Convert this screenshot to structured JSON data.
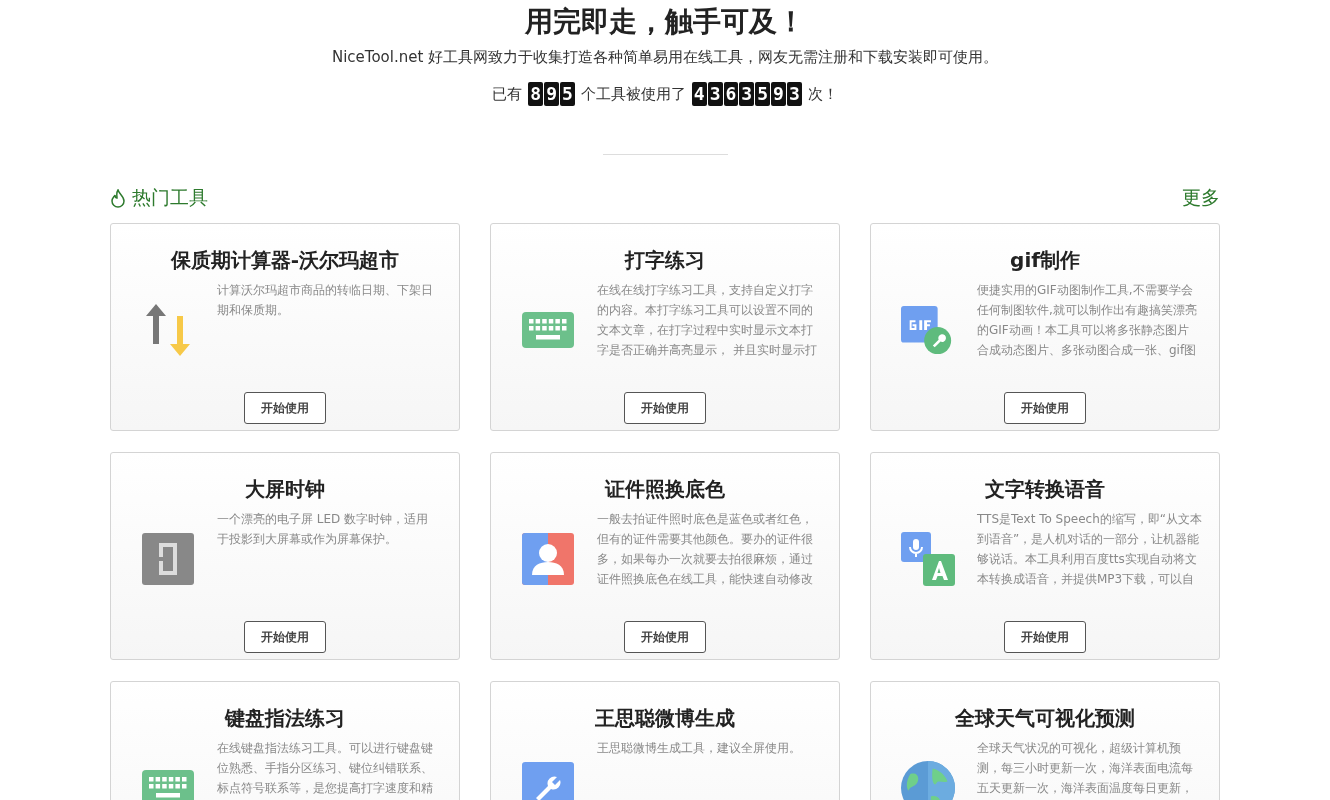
{
  "header": {
    "title": "用完即走，触手可及！",
    "subtitle": "NiceTool.net 好工具网致力于收集打造各种简单易用在线工具，网友无需注册和下载安装即可使用。",
    "stats": {
      "prefix": "已有",
      "tool_count": "895",
      "middle": "个工具被使用了",
      "use_count": "4363593",
      "suffix": "次！"
    }
  },
  "section": {
    "title": "热门工具",
    "more": "更多"
  },
  "tools": [
    {
      "kind": "arrows",
      "title": "保质期计算器-沃尔玛超市",
      "description": [
        "计算沃尔玛超市商品的转临日期、下架日",
        "期和保质期。"
      ],
      "button": "开始使用"
    },
    {
      "kind": "keyboard",
      "title": "打字练习",
      "description": [
        "在线在线打字练习工具，支持自定义打字",
        "的内容。本打字练习工具可以设置不同的",
        "文本文章，在打字过程中实时显示文本打",
        "字是否正确并高亮显示， 并且实时显示打"
      ],
      "button": "开始使用"
    },
    {
      "kind": "gif",
      "title": "gif制作",
      "description": [
        "便捷实用的GIF动图制作工具,不需要学会",
        "任何制图软件,就可以制作出有趣搞笑漂亮",
        "的GIF动画！本工具可以将多张静态图片",
        "合成动态图片、多张动图合成一张、gif图"
      ],
      "button": "开始使用"
    },
    {
      "kind": "led",
      "title": "大屏时钟",
      "description": [
        "一个漂亮的电子屏 LED 数字时钟，适用",
        "于投影到大屏幕或作为屏幕保护。"
      ],
      "button": "开始使用"
    },
    {
      "kind": "idphoto",
      "title": "证件照换底色",
      "description": [
        "一般去拍证件照时底色是蓝色或者红色，",
        "但有的证件需要其他颜色。要办的证件很",
        "多，如果每办一次就要去拍很麻烦，通过",
        "证件照换底色在线工具，能快速自动修改"
      ],
      "button": "开始使用"
    },
    {
      "kind": "tts",
      "title": "文字转换语音",
      "description": [
        "TTS是Text To Speech的缩写，即“从文本",
        "到语音”，是人机对话的一部分，让机器能",
        "够说话。本工具利用百度tts实现自动将文",
        "本转换成语音，并提供MP3下载，可以自"
      ],
      "button": "开始使用"
    },
    {
      "kind": "keyboard",
      "title": "键盘指法练习",
      "description": [
        "在线键盘指法练习工具。可以进行键盘键",
        "位熟悉、手指分区练习、键位纠错联系、",
        "标点符号联系等，是您提高打字速度和精"
      ]
    },
    {
      "kind": "wrench",
      "title": "王思聪微博生成",
      "description": [
        "王思聪微博生成工具，建议全屏使用。"
      ]
    },
    {
      "kind": "globe",
      "title": "全球天气可视化预测",
      "description": [
        "全球天气状况的可视化，超级计算机预",
        "测，每三小时更新一次，海洋表面电流每",
        "五天更新一次，海洋表面温度每日更新，"
      ]
    }
  ]
}
